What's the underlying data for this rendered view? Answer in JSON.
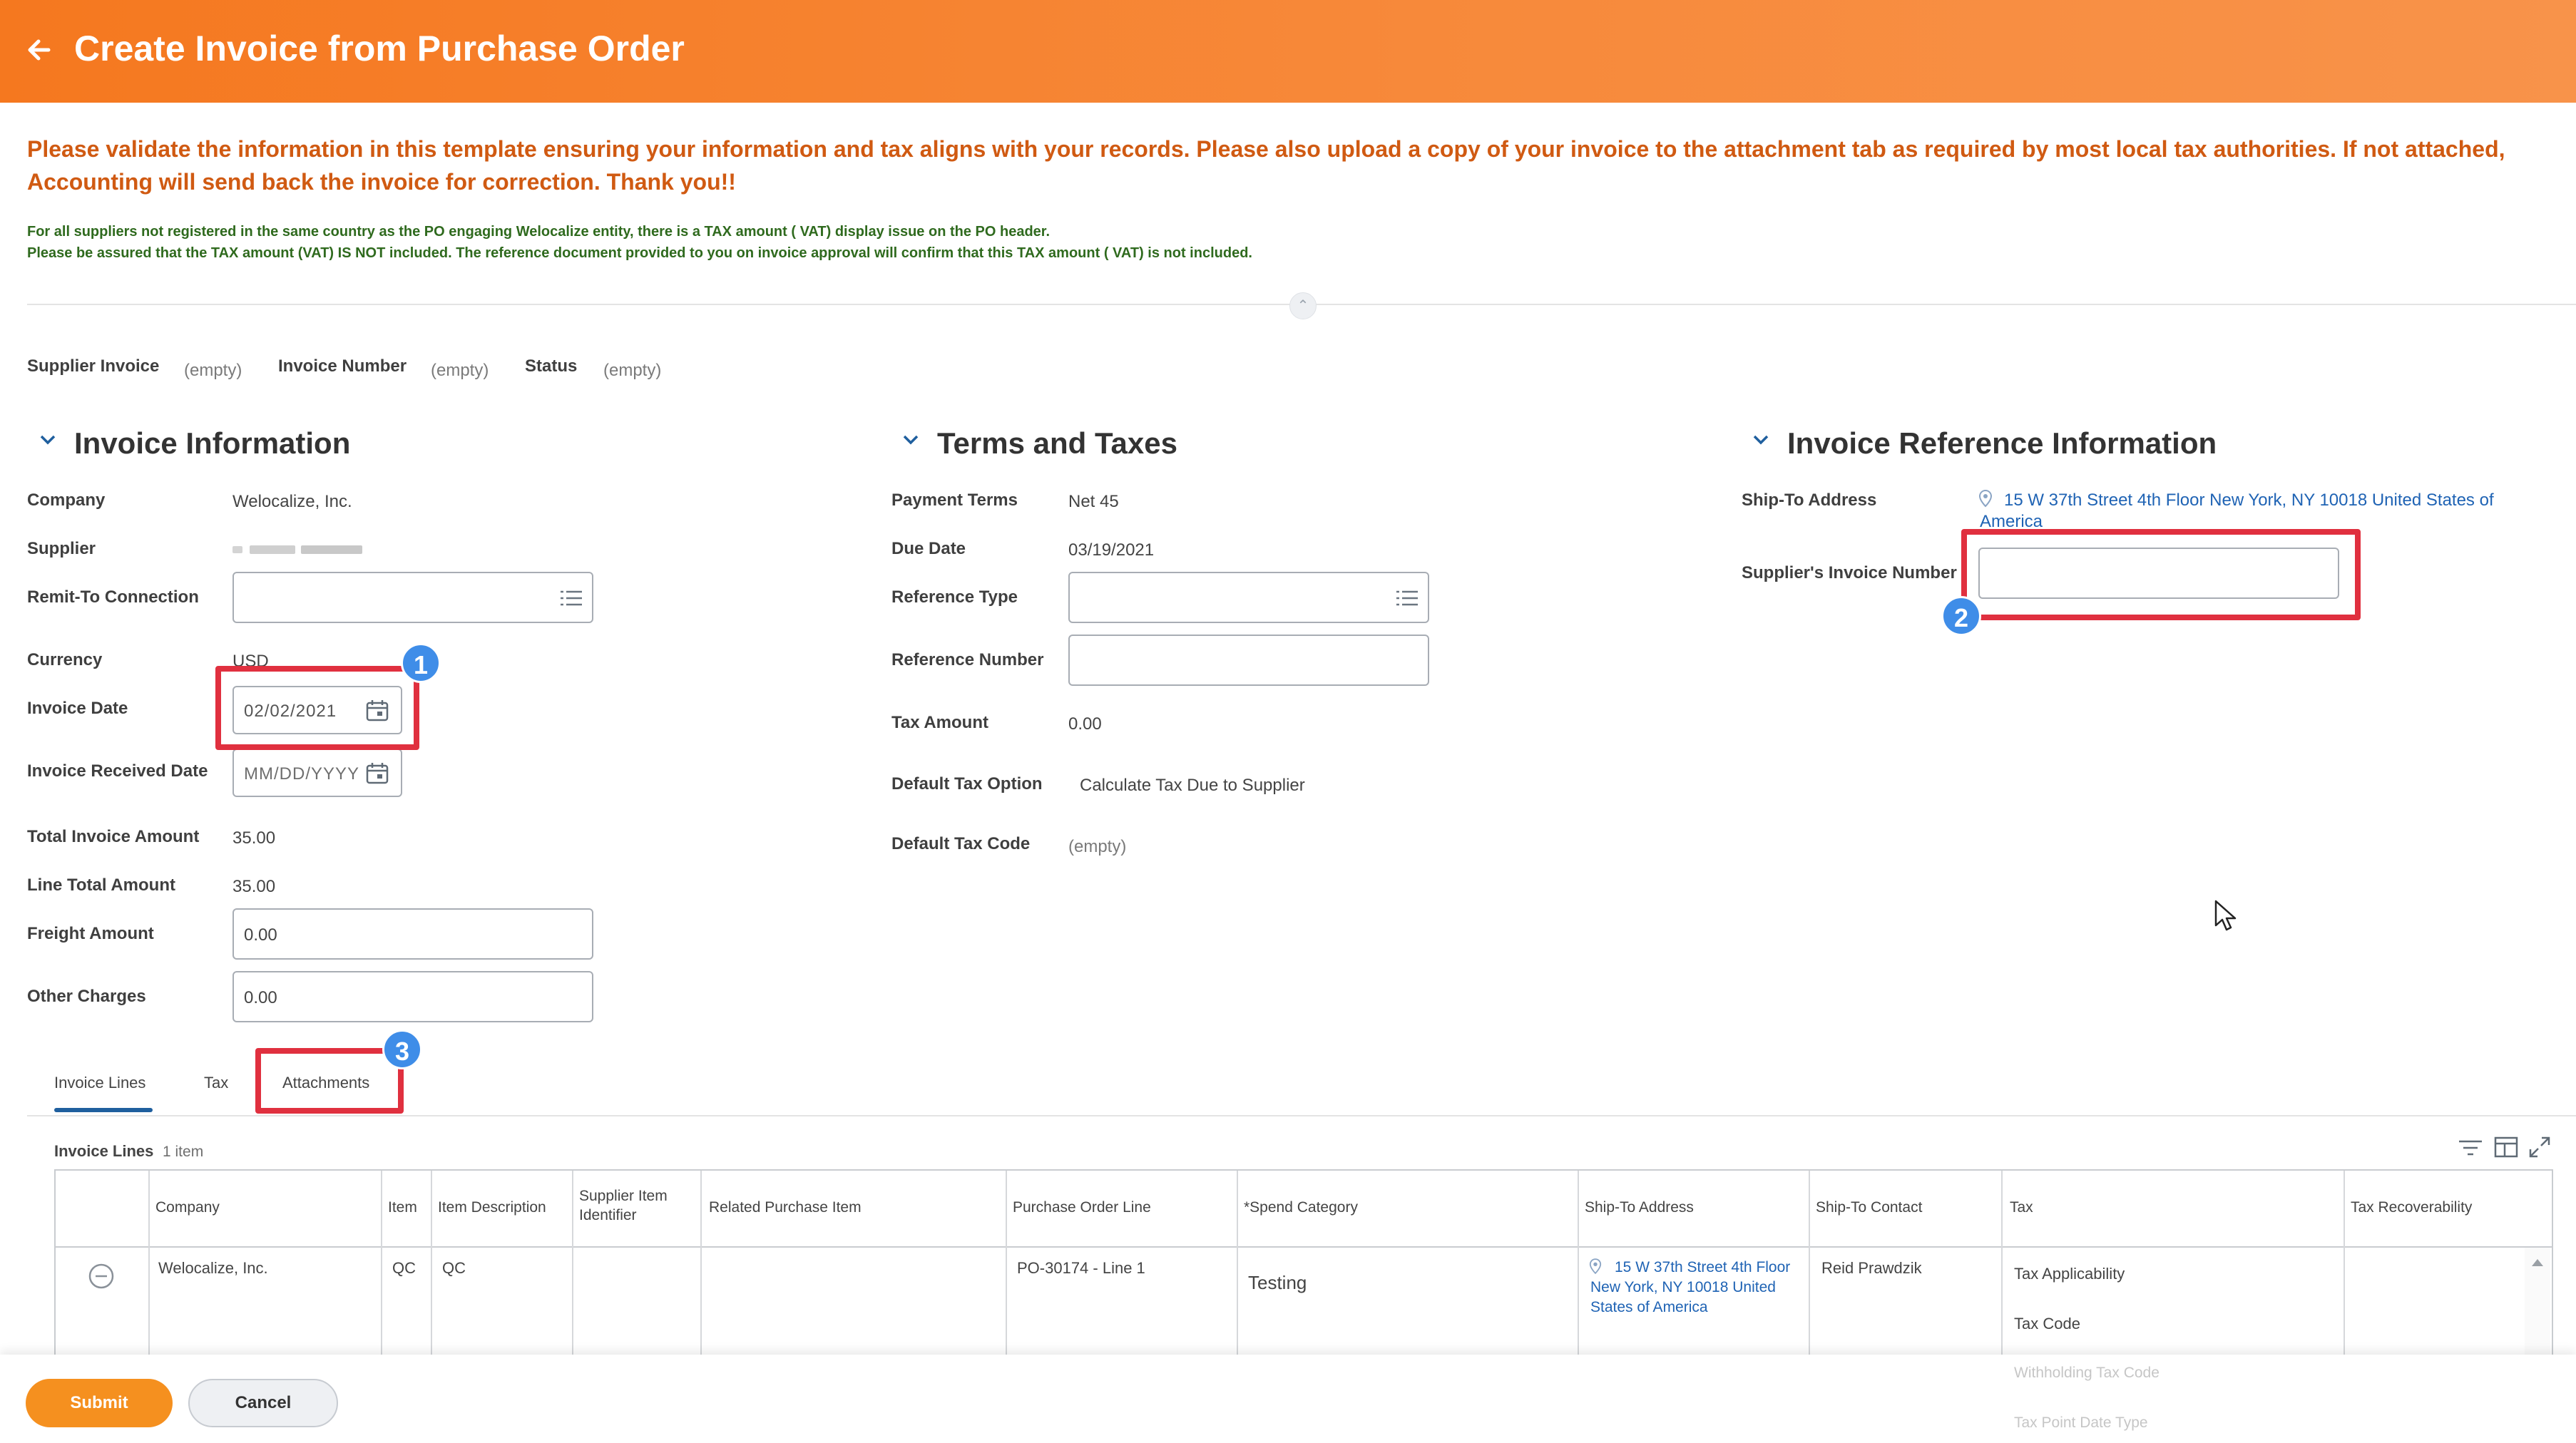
{
  "header": {
    "title": "Create Invoice from Purchase Order",
    "back_icon": "back-arrow-icon"
  },
  "notice": {
    "main": "Please validate the information in this template ensuring your information and tax aligns with your records. Please also upload a copy of your invoice to the attachment tab as required by most local tax authorities. If not attached, Accounting will send back the invoice for correction. Thank you!!",
    "vat_line1": "For all suppliers not registered in the same country as the PO engaging Welocalize entity, there is a TAX amount  ( VAT) display issue on the PO header.",
    "vat_line2": "Please be assured that the TAX amount (VAT)  IS NOT included. The reference document provided to you on invoice approval will confirm that this TAX amount ( VAT) is not included."
  },
  "summary": {
    "supplier_invoice_label": "Supplier Invoice",
    "supplier_invoice_value": "(empty)",
    "invoice_number_label": "Invoice Number",
    "invoice_number_value": "(empty)",
    "status_label": "Status",
    "status_value": "(empty)"
  },
  "invoice_info": {
    "title": "Invoice Information",
    "company_label": "Company",
    "company_value": "Welocalize, Inc.",
    "supplier_label": "Supplier",
    "remit_label": "Remit-To Connection",
    "currency_label": "Currency",
    "currency_value": "USD",
    "invoice_date_label": "Invoice Date",
    "invoice_date_value": "02/02/2021",
    "received_date_label": "Invoice Received Date",
    "received_date_placeholder": "MM/DD/YYYY",
    "total_label": "Total Invoice Amount",
    "total_value": "35.00",
    "line_total_label": "Line Total Amount",
    "line_total_value": "35.00",
    "freight_label": "Freight Amount",
    "freight_value": "0.00",
    "other_label": "Other Charges",
    "other_value": "0.00"
  },
  "terms": {
    "title": "Terms and Taxes",
    "payment_terms_label": "Payment Terms",
    "payment_terms_value": "Net 45",
    "due_date_label": "Due Date",
    "due_date_value": "03/19/2021",
    "ref_type_label": "Reference Type",
    "ref_number_label": "Reference Number",
    "tax_amount_label": "Tax Amount",
    "tax_amount_value": "0.00",
    "default_tax_option_label": "Default Tax Option",
    "default_tax_option_value": "Calculate Tax Due to Supplier",
    "default_tax_code_label": "Default Tax Code",
    "default_tax_code_value": "(empty)"
  },
  "reference": {
    "title": "Invoice Reference Information",
    "ship_to_label": "Ship-To Address",
    "ship_to_value_line1": "15 W 37th Street 4th Floor New York, NY 10018 United States of",
    "ship_to_value_line2": "America",
    "supplier_invoice_number_label": "Supplier's Invoice Number"
  },
  "callouts": {
    "one": "1",
    "two": "2",
    "three": "3"
  },
  "tabs": {
    "invoice_lines": "Invoice Lines",
    "tax": "Tax",
    "attachments": "Attachments"
  },
  "lines_table": {
    "title": "Invoice Lines",
    "count": "1 item",
    "headers": [
      "Company",
      "Item",
      "Item Description",
      "Supplier Item Identifier",
      "Related Purchase Item",
      "Purchase Order Line",
      "*Spend Category",
      "Ship-To Address",
      "Ship-To Contact",
      "Tax",
      "Tax Recoverability"
    ],
    "row": {
      "company": "Welocalize, Inc.",
      "item": "QC",
      "item_description": "QC",
      "po_line": "PO-30174 - Line 1",
      "spend_category": "Testing",
      "ship_to_line1": "15 W 37th Street 4th Floor",
      "ship_to_line2": "New York, NY 10018 United",
      "ship_to_line3": "States of America",
      "contact": "Reid Prawdzik",
      "tax_applicability": "Tax Applicability",
      "tax_code": "Tax Code",
      "withholding_tax_code": "Withholding Tax Code",
      "tax_point_date_type": "Tax Point Date Type"
    }
  },
  "footer": {
    "submit": "Submit",
    "cancel": "Cancel"
  },
  "colors": {
    "brand_orange": "#f5781f",
    "callout_red": "#e0303f",
    "badge_blue": "#3f8de8",
    "link_blue": "#1f63b4"
  }
}
